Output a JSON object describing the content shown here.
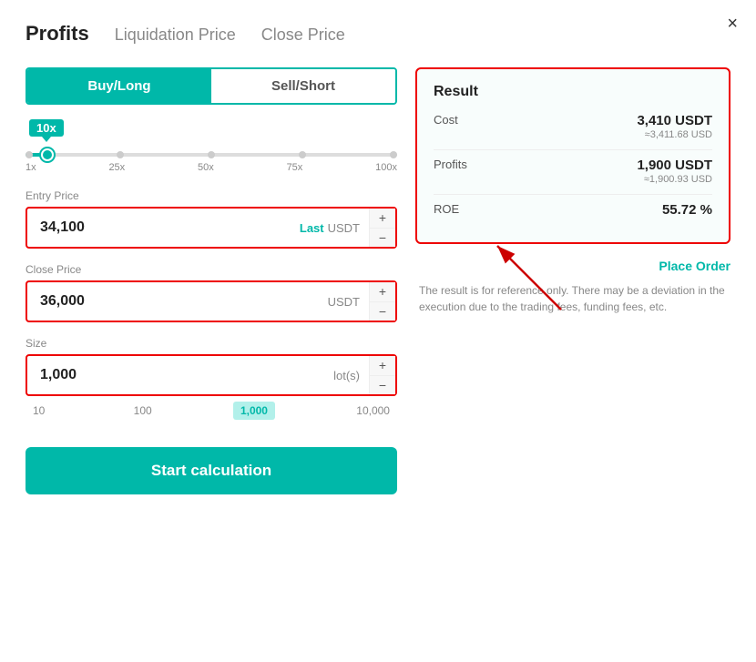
{
  "modal": {
    "close_label": "×"
  },
  "tabs": {
    "active": "Profits",
    "items": [
      {
        "label": "Profits",
        "active": true
      },
      {
        "label": "Liquidation Price",
        "active": false
      },
      {
        "label": "Close Price",
        "active": false
      }
    ]
  },
  "toggle": {
    "buy_label": "Buy/Long",
    "sell_label": "Sell/Short"
  },
  "leverage": {
    "value": "10x",
    "marks": [
      "1x",
      "25x",
      "50x",
      "75x",
      "100x"
    ]
  },
  "entry_price": {
    "label": "Entry Price",
    "value": "34,100",
    "last_label": "Last",
    "unit": "USDT",
    "plus": "+",
    "minus": "−"
  },
  "close_price": {
    "label": "Close Price",
    "value": "36,000",
    "unit": "USDT",
    "plus": "+",
    "minus": "−"
  },
  "size": {
    "label": "Size",
    "value": "1,000",
    "unit": "lot(s)",
    "plus": "+",
    "minus": "−",
    "options": [
      "10",
      "100",
      "1,000",
      "10,000"
    ]
  },
  "calc_button": {
    "label": "Start calculation"
  },
  "result": {
    "title": "Result",
    "rows": [
      {
        "key": "Cost",
        "main_val": "3,410 USDT",
        "sub_val": "≈3,411.68 USD"
      },
      {
        "key": "Profits",
        "main_val": "1,900 USDT",
        "sub_val": "≈1,900.93 USD"
      },
      {
        "key": "ROE",
        "main_val": "55.72 %",
        "sub_val": ""
      }
    ],
    "place_order": "Place Order",
    "disclaimer": "The result is for reference only. There may be a deviation in the execution due to the trading fees, funding fees, etc."
  }
}
